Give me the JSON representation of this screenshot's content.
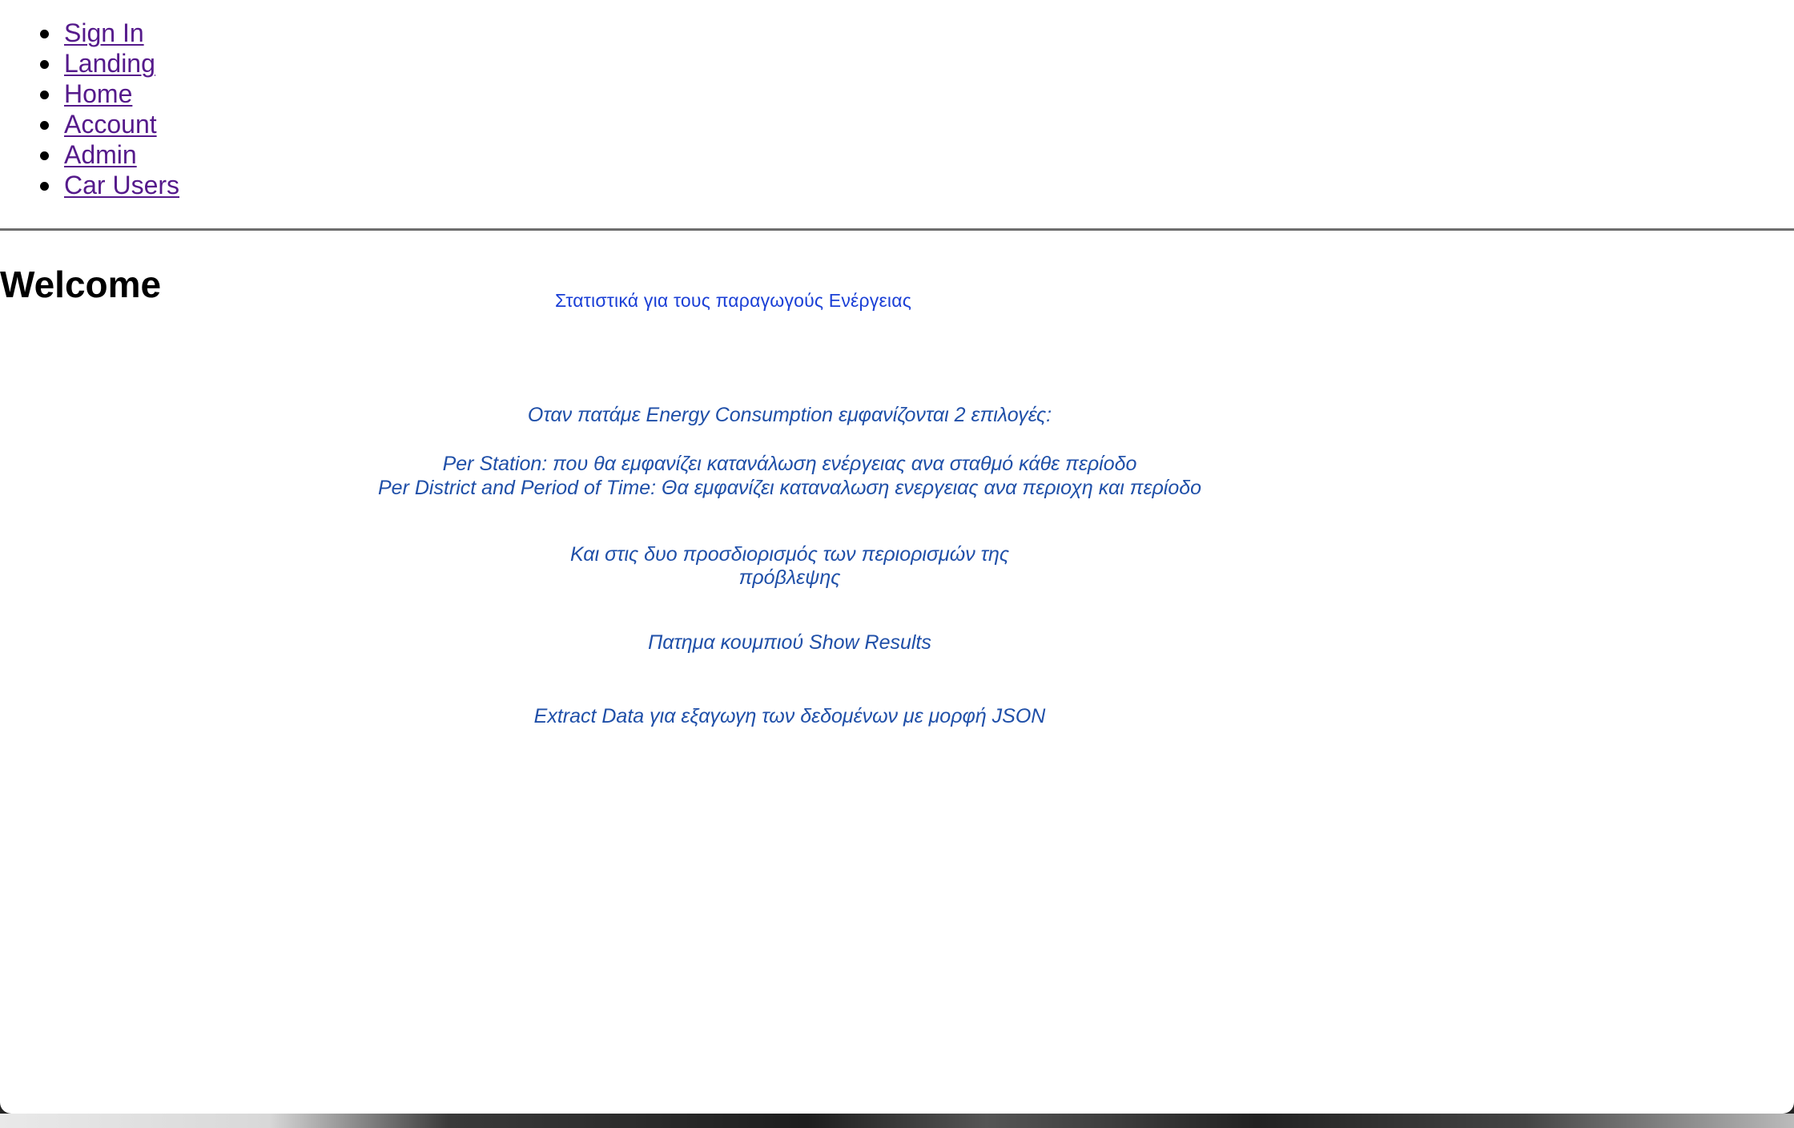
{
  "nav": {
    "items": [
      {
        "label": "Sign In"
      },
      {
        "label": "Landing"
      },
      {
        "label": "Home"
      },
      {
        "label": "Account"
      },
      {
        "label": "Admin"
      },
      {
        "label": "Car Users"
      }
    ]
  },
  "main": {
    "heading": "Welcome",
    "stats_title": "Στατιστικά για τους παραγωγούς Ενέργειας",
    "info_lines": [
      "Οταν πατάμε Energy Consumption εμφανίζονται 2 επιλογές:",
      "Per Station: που θα εμφανίζει κατανάλωση ενέργειας ανα σταθμό κάθε περίοδο",
      "Per District and Period of Time: Θα εμφανίζει καταναλωση ενεργειας ανα περιοχη και περίοδο",
      "Και στις δυο προσδιορισμός των περιορισμών της",
      "πρόβλεψης",
      "Πατημα κουμπιού Show Results",
      "Extract Data για εξαγωγη των δεδομένων με μορφή JSON"
    ]
  },
  "colors": {
    "link": "#551a8b",
    "stats_title": "#1a3fd6",
    "info_text": "#1f4fa8"
  }
}
